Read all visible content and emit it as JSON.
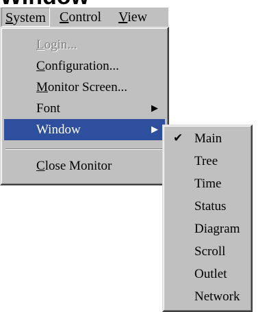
{
  "page": {
    "cutoff_title": "Window"
  },
  "menubar": {
    "items": [
      {
        "accel": "S",
        "rest": "ystem"
      },
      {
        "accel": "C",
        "rest": "ontrol"
      },
      {
        "accel": "V",
        "rest": "iew"
      }
    ]
  },
  "system_menu": {
    "items": [
      {
        "accel": "L",
        "rest": "ogin...",
        "disabled": true
      },
      {
        "accel": "C",
        "rest": "onfiguration..."
      },
      {
        "accel": "M",
        "rest": "onitor Screen..."
      },
      {
        "label": "Font",
        "submenu": true
      },
      {
        "label": "Window",
        "submenu": true,
        "highlighted": true
      },
      {
        "accel": "C",
        "rest": "lose Monitor"
      }
    ],
    "submenu_arrow": "▶"
  },
  "window_submenu": {
    "check_mark": "✔",
    "items": [
      {
        "label": "Main",
        "checked": true
      },
      {
        "label": "Tree"
      },
      {
        "label": "Time"
      },
      {
        "label": "Status"
      },
      {
        "label": "Diagram"
      },
      {
        "label": "Scroll"
      },
      {
        "label": "Outlet"
      },
      {
        "label": "Network"
      }
    ]
  }
}
